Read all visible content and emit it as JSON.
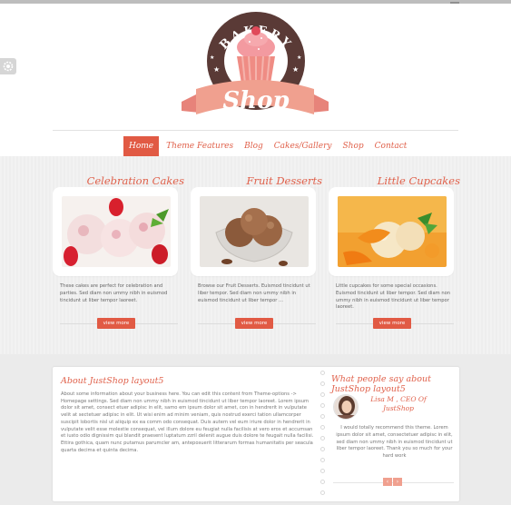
{
  "logo": {
    "arc_text": "BAKERY",
    "ribbon_text": "Shop"
  },
  "nav": {
    "items": [
      {
        "label": "Home",
        "active": true
      },
      {
        "label": "Theme Features",
        "active": false
      },
      {
        "label": "Blog",
        "active": false
      },
      {
        "label": "Cakes/Gallery",
        "active": false
      },
      {
        "label": "Shop",
        "active": false
      },
      {
        "label": "Contact",
        "active": false
      }
    ]
  },
  "features": [
    {
      "title": "Celebration Cakes",
      "image": "strawberry-ice-cream-icon",
      "text": "These cakes are perfect for celebration and parties. Sed diam non ummy nibh in euismod tincidunt ut liber tempor laoreet.",
      "button": "view more"
    },
    {
      "title": "Fruit Desserts",
      "image": "chocolate-ice-cream-icon",
      "text": "Browse our Fruit Desserts. Euismod tincidunt ut liber tempor. Sed diam non ummy nibh in euismod tincidunt ut liber tempor ...",
      "button": "view more"
    },
    {
      "title": "Little Cupcakes",
      "image": "fruit-sorbet-icon",
      "text": "Little cupcakes for some special occasions. Euismod tincidunt ut liber tempor. Sed diam non ummy nibh in euismod tincidunt ut liber tempor laoreet.",
      "button": "view more"
    }
  ],
  "about": {
    "title": "About JustShop layout5",
    "text": "About some information about your business here. You can edit this content from Theme-options -> Homepage settings. Sed diam non ummy nibh in euismod tincidunt ut liber tempor laoreet. Lorem ipsum dolor sit amet, consect etuer adipisc in elit, samo em ipsum dolor sit amet, con in hendrerit in vulputate velit at sectetuer adipisc in elit. Ut wisi enim ad minim veniam, quis nostrud exerci tation ullamcorper suscipit lobortis nisl ut aliquip ex ea comm odo consequat. Duis autem vel eum iriure dolor in hendrerit in vulputate velit esse molestie consequat, vel illum dolore eu feugiat nulla facilisis at vero eros et accumsan et iusto odio dignissim qui blandit praesent luptatum zzril delenit augue duis dolore te feugait nulla facilisi. Ettira gothica, quam nunc putamus parumcler am, anteposuerit litterarum formas humanitatis per seacula quarta decima et quinta decima."
  },
  "testimonials": {
    "title": "What people say about JustShop layout5",
    "author_line1": "Lisa M , CEO Of",
    "author_line2": "JustShop",
    "quote": "I would totally recommend this theme.  Lorem ipsum dolor sit amet, consectetuer adipisc in elit, sed diam non ummy nibh in euismod tincidunt ut liber tempor laoreet. Thank you so much for your hard work"
  },
  "colors": {
    "accent": "#e15a44",
    "logo_brown": "#5a3a36",
    "logo_pink": "#f0a08f"
  }
}
